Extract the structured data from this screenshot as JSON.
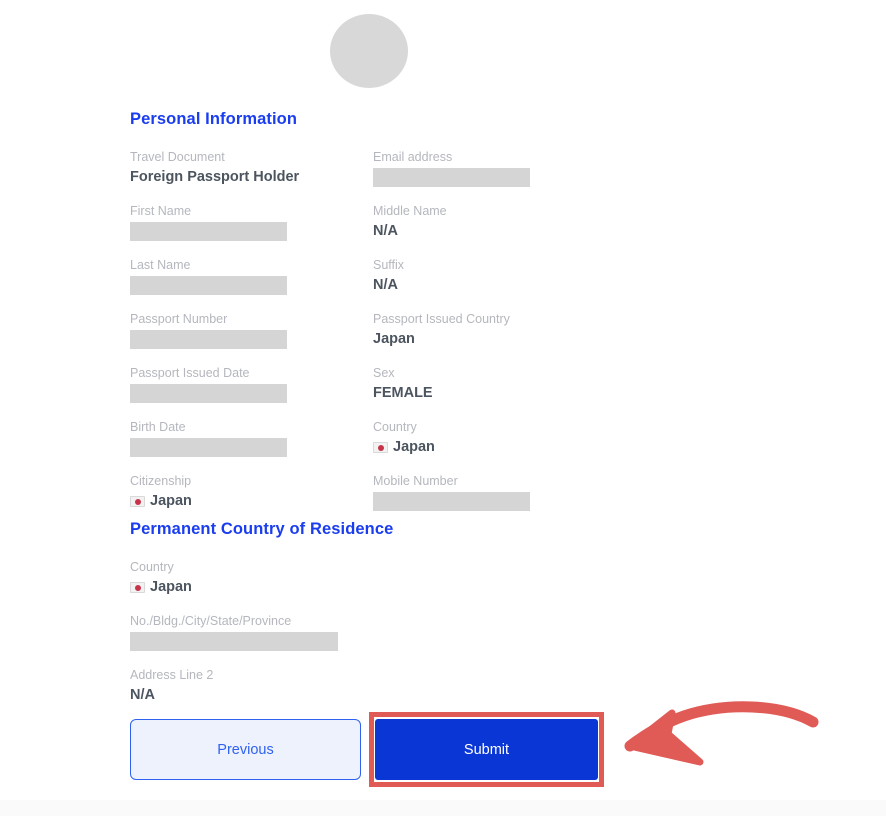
{
  "avatar": {
    "icon": "avatar-placeholder-circle"
  },
  "sections": [
    {
      "id": "personal-information",
      "title": "Personal Information",
      "fields": [
        {
          "label": "Travel Document",
          "value": "Foreign Passport Holder",
          "type": "text",
          "column": "left"
        },
        {
          "label": "Email address",
          "value": "",
          "type": "blank",
          "column": "right"
        },
        {
          "label": "First Name",
          "value": "",
          "type": "blank",
          "column": "left"
        },
        {
          "label": "Middle Name",
          "value": "N/A",
          "type": "text",
          "column": "right"
        },
        {
          "label": "Last Name",
          "value": "",
          "type": "blank",
          "column": "left"
        },
        {
          "label": "Suffix",
          "value": "N/A",
          "type": "text",
          "column": "right"
        },
        {
          "label": "Passport Number",
          "value": "",
          "type": "blank",
          "column": "left"
        },
        {
          "label": "Passport Issued Country",
          "value": "Japan",
          "type": "text",
          "column": "right"
        },
        {
          "label": "Passport Issued Date",
          "value": "",
          "type": "blank",
          "column": "left"
        },
        {
          "label": "Sex",
          "value": "FEMALE",
          "type": "text",
          "column": "right"
        },
        {
          "label": "Birth Date",
          "value": "",
          "type": "blank",
          "column": "left"
        },
        {
          "label": "Country",
          "value": "Japan",
          "type": "flag",
          "icon": "japan-flag-icon",
          "column": "right"
        },
        {
          "label": "Citizenship",
          "value": "Japan",
          "type": "flag",
          "icon": "japan-flag-icon",
          "column": "left"
        },
        {
          "label": "Mobile Number",
          "value": "",
          "type": "blank",
          "column": "right"
        }
      ]
    },
    {
      "id": "permanent-country-of-residence",
      "title": "Permanent Country of Residence",
      "fields": [
        {
          "label": "Country",
          "value": "Japan",
          "type": "flag",
          "icon": "japan-flag-icon",
          "column": "left"
        },
        {
          "label": "No./Bldg./City/State/Province",
          "value": "",
          "type": "blank",
          "column": "left"
        },
        {
          "label": "Address Line 2",
          "value": "N/A",
          "type": "text",
          "column": "left"
        }
      ]
    }
  ],
  "buttons": {
    "previous": "Previous",
    "submit": "Submit"
  },
  "annotation": {
    "type": "curved-arrow-pointing-left",
    "target": "submit-button",
    "color": "#e05a56"
  },
  "colors": {
    "heading_blue": "#1a3df0",
    "submit_blue": "#0b36d6",
    "previous_border": "#2f62f0",
    "previous_fill": "#eef2fd",
    "label_gray": "#b4b7bd",
    "value_gray": "#4c555f",
    "field_fill": "#d5d5d5",
    "annotation_red": "#e05a56"
  }
}
